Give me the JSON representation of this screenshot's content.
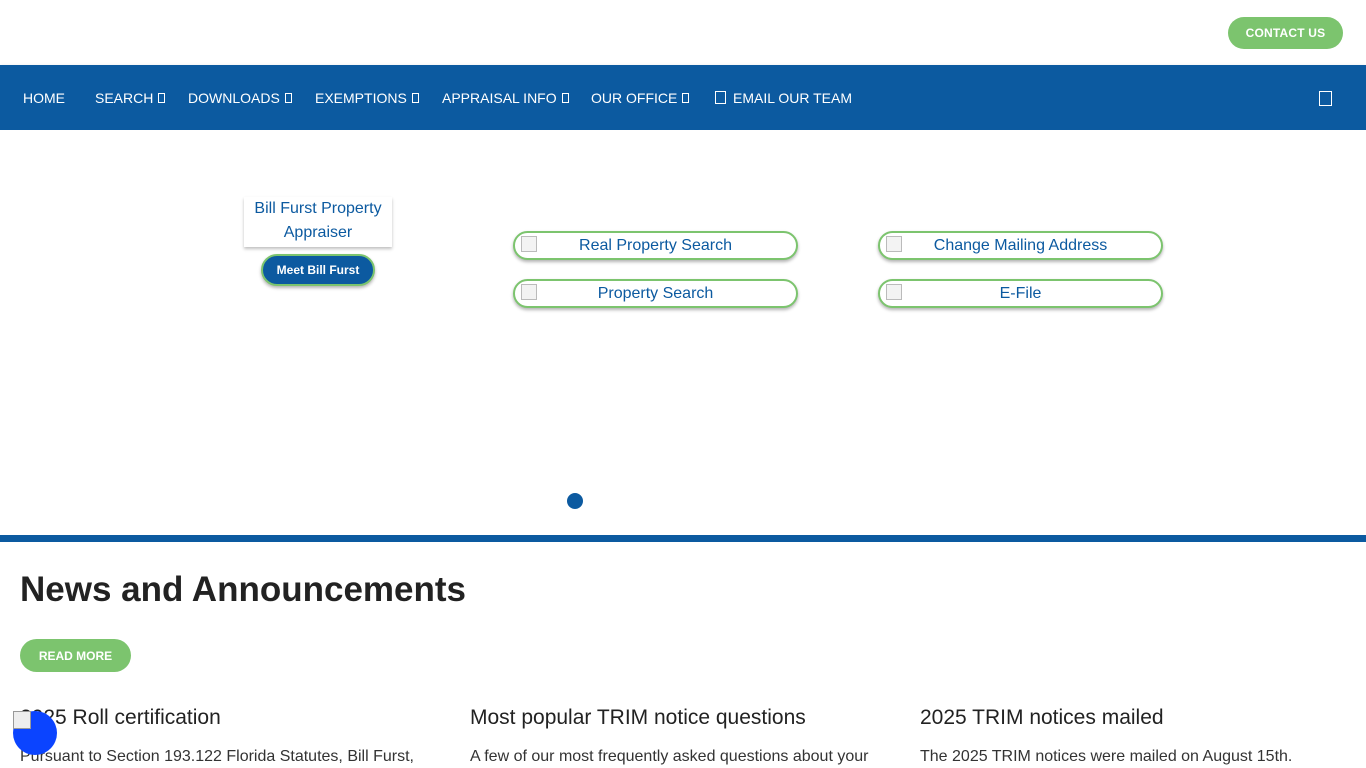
{
  "header": {
    "contact_label": "CONTACT US"
  },
  "nav": {
    "items": [
      {
        "label": "HOME",
        "dropdown": false
      },
      {
        "label": "SEARCH",
        "dropdown": true
      },
      {
        "label": "DOWNLOADS",
        "dropdown": true
      },
      {
        "label": "EXEMPTIONS",
        "dropdown": true
      },
      {
        "label": "APPRAISAL INFO",
        "dropdown": true
      },
      {
        "label": "OUR OFFICE",
        "dropdown": true
      }
    ],
    "email_label": "EMAIL OUR TEAM",
    "email_icon": "envelope-icon",
    "menu_icon": "menu-toggle-icon"
  },
  "hero": {
    "appraiser_image_alt": "Bill Furst Property Appraiser",
    "meet_label": "Meet Bill Furst",
    "quick_links": [
      {
        "label": "Real Property Search"
      },
      {
        "label": "Change Mailing Address"
      },
      {
        "label": "Property Search"
      },
      {
        "label": "E-File"
      }
    ],
    "slide_count": 1,
    "active_slide": 1
  },
  "news": {
    "title": "News and Announcements",
    "read_more_label": "READ MORE",
    "cards": [
      {
        "title": "2025 Roll certification",
        "excerpt": "Pursuant to Section 193.122 Florida Statutes, Bill Furst,"
      },
      {
        "title": "Most popular TRIM notice questions",
        "excerpt": "A few of our most frequently asked questions about your"
      },
      {
        "title": "2025 TRIM notices mailed",
        "excerpt": "The 2025 TRIM notices were mailed on August 15th."
      }
    ]
  },
  "colors": {
    "brand_blue": "#0c5aa0",
    "accent_green": "#7cc46e",
    "accessibility_blue": "#0b44ff"
  }
}
